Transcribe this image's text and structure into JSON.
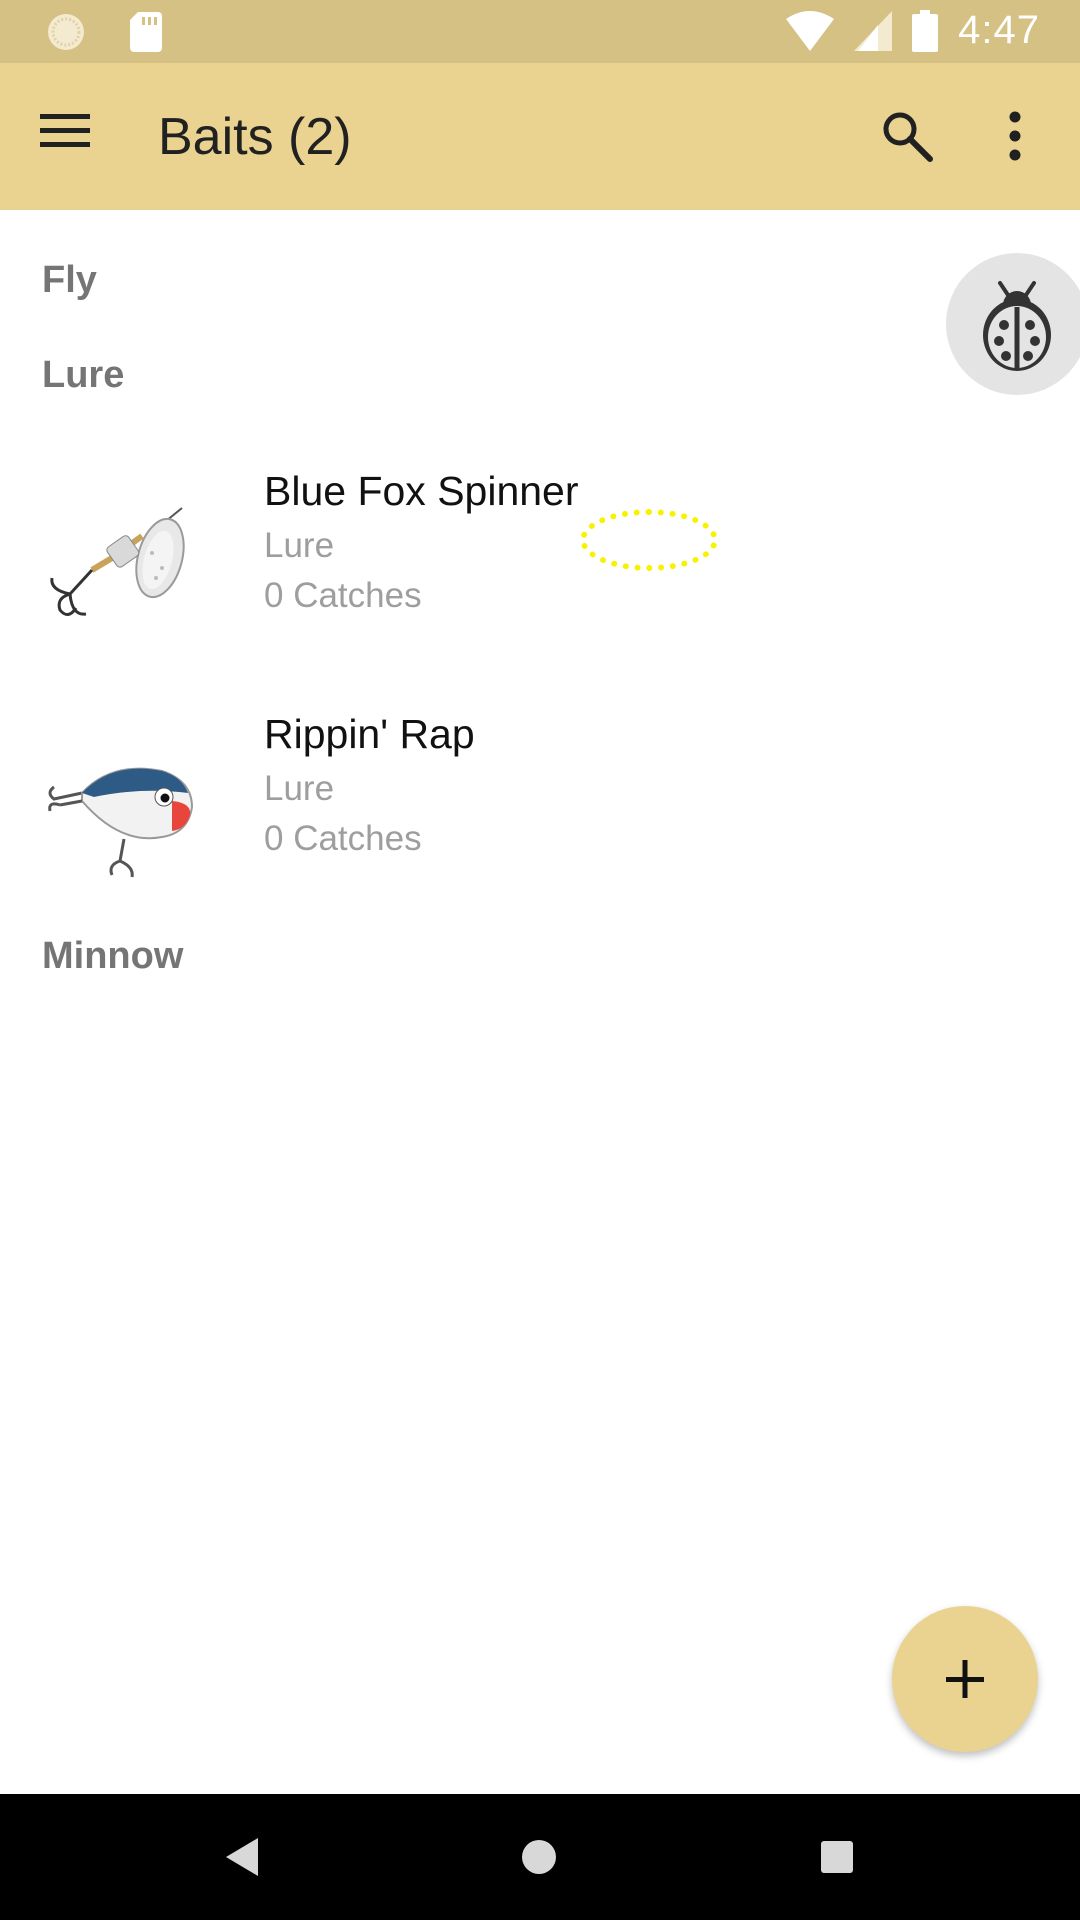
{
  "status_bar": {
    "time": "4:47",
    "icons": [
      "brightness-icon",
      "sd-card-icon",
      "wifi-icon",
      "signal-icon",
      "battery-icon"
    ]
  },
  "app_bar": {
    "title": "Baits (2)",
    "icons": [
      "menu-icon",
      "search-icon",
      "more-vert-icon"
    ]
  },
  "sections": [
    {
      "label": "Fly",
      "items": []
    },
    {
      "label": "Lure",
      "items": [
        {
          "name": "Blue Fox Spinner",
          "type": "Lure",
          "catches": "0 Catches",
          "image": "spinner-lure-image"
        },
        {
          "name": "Rippin' Rap",
          "type": "Lure",
          "catches": "0 Catches",
          "image": "crankbait-lure-image"
        }
      ]
    },
    {
      "label": "Minnow",
      "items": []
    }
  ],
  "fab": {
    "icon": "plus-icon"
  },
  "debug_fab": {
    "icon": "ladybug-icon"
  },
  "nav_bar": {
    "icons": [
      "back-icon",
      "home-icon",
      "recents-icon"
    ]
  },
  "colors": {
    "status_bar": "#d4c183",
    "app_bar": "#ead391",
    "fab": "#ead391",
    "section_header": "#757575",
    "secondary_text": "#9e9e9e",
    "touch_indicator": "#f6f200"
  }
}
